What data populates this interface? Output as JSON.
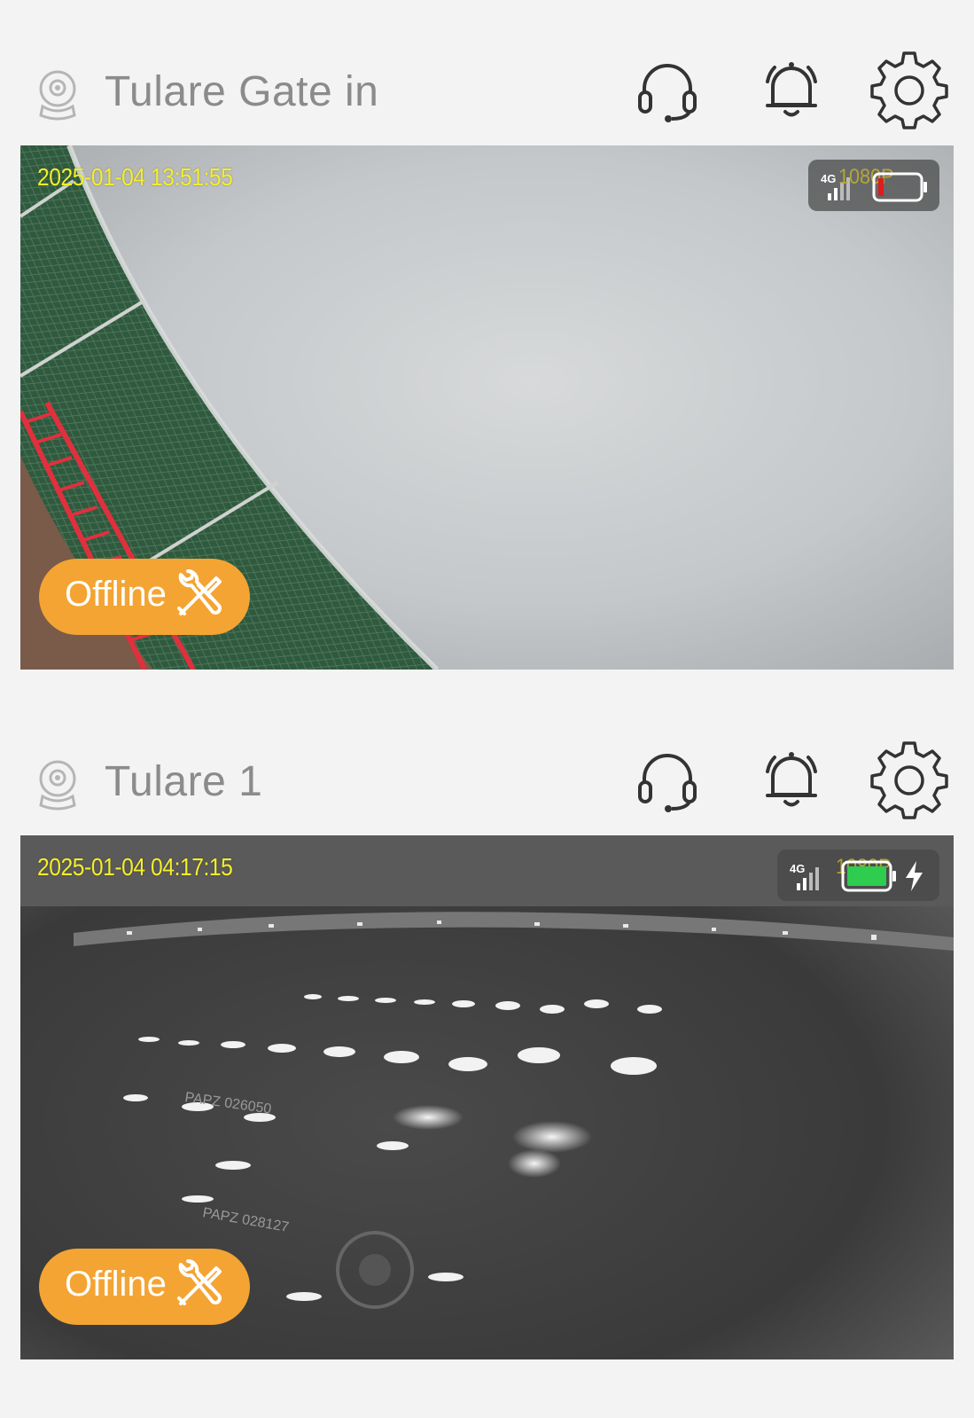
{
  "cameras": [
    {
      "name": "Tulare Gate in",
      "timestamp": "2025-01-04  13:51:55",
      "network": "4G",
      "resolution": "1080P",
      "battery": {
        "level": 0.1,
        "color": "#e01b1b",
        "charging": false
      },
      "status_label": "Offline",
      "icons": {
        "camera": "camera-icon",
        "support": "headset-icon",
        "alerts": "bell-icon",
        "settings": "gear-icon",
        "repair": "tools-icon"
      }
    },
    {
      "name": "Tulare 1",
      "timestamp": "2025-01-04  04:17:15",
      "network": "4G",
      "resolution": "1080P",
      "battery": {
        "level": 1.0,
        "color": "#2ecc4f",
        "charging": true
      },
      "status_label": "Offline",
      "icons": {
        "camera": "camera-icon",
        "support": "headset-icon",
        "alerts": "bell-icon",
        "settings": "gear-icon",
        "repair": "tools-icon",
        "charging": "bolt-icon"
      }
    }
  ],
  "colors": {
    "background": "#f3f3f3",
    "offline_badge": "#f4a433",
    "timestamp": "#f5ee2a",
    "title": "#8b8b8b"
  }
}
